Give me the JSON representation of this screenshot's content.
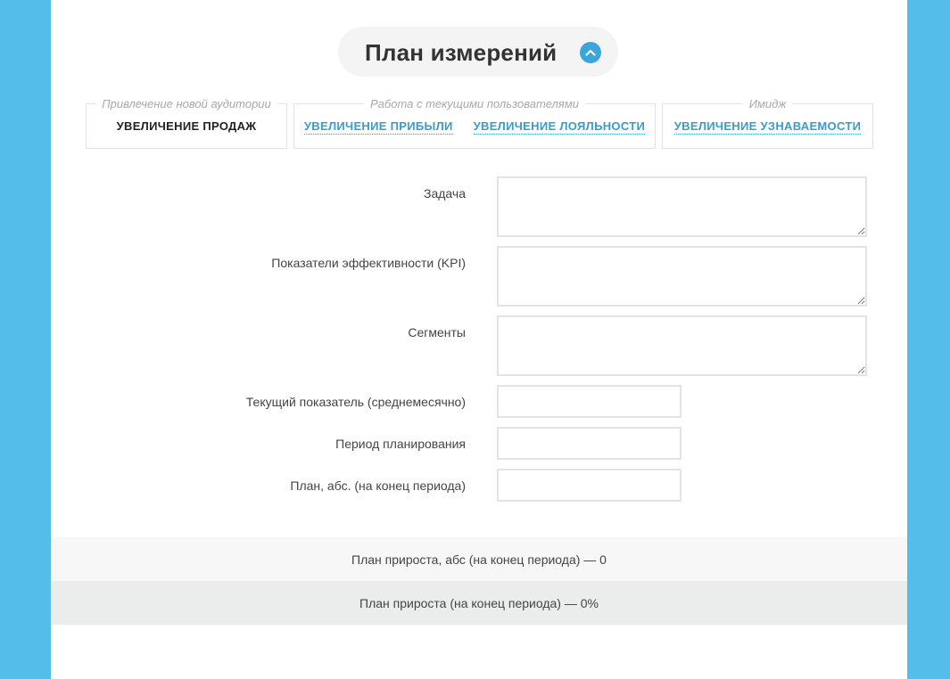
{
  "header": {
    "title": "План измерений"
  },
  "goal_groups": [
    {
      "legend": "Привлечение новой аудитории",
      "options": [
        {
          "label": "УВЕЛИЧЕНИЕ ПРОДАЖ",
          "selected": true
        }
      ]
    },
    {
      "legend": "Работа с текущими пользователями",
      "options": [
        {
          "label": "УВЕЛИЧЕНИЕ ПРИБЫЛИ",
          "selected": false
        },
        {
          "label": "УВЕЛИЧЕНИЕ ЛОЯЛЬНОСТИ",
          "selected": false
        }
      ]
    },
    {
      "legend": "Имидж",
      "options": [
        {
          "label": "УВЕЛИЧЕНИЕ УЗНАВАЕМОСТИ",
          "selected": false
        }
      ]
    }
  ],
  "form": {
    "task_label": "Задача",
    "task_value": "",
    "kpi_label": "Показатели эффективности (KPI)",
    "kpi_value": "",
    "segments_label": "Сегменты",
    "segments_value": "",
    "current_label": "Текущий показатель (среднемесячно)",
    "current_value": "",
    "period_label": "Период планирования",
    "period_value": "",
    "plan_label": "План, абс. (на конец периода)",
    "plan_value": ""
  },
  "results": {
    "growth_abs": "План прироста, абс (на конец периода) — 0",
    "growth_pct": "План прироста (на конец периода) — 0%"
  },
  "colors": {
    "background": "#55bde9",
    "accent": "#3ba6dc",
    "link": "#3a9cc9"
  },
  "icons": {
    "collapse": "chevron-up-icon"
  }
}
